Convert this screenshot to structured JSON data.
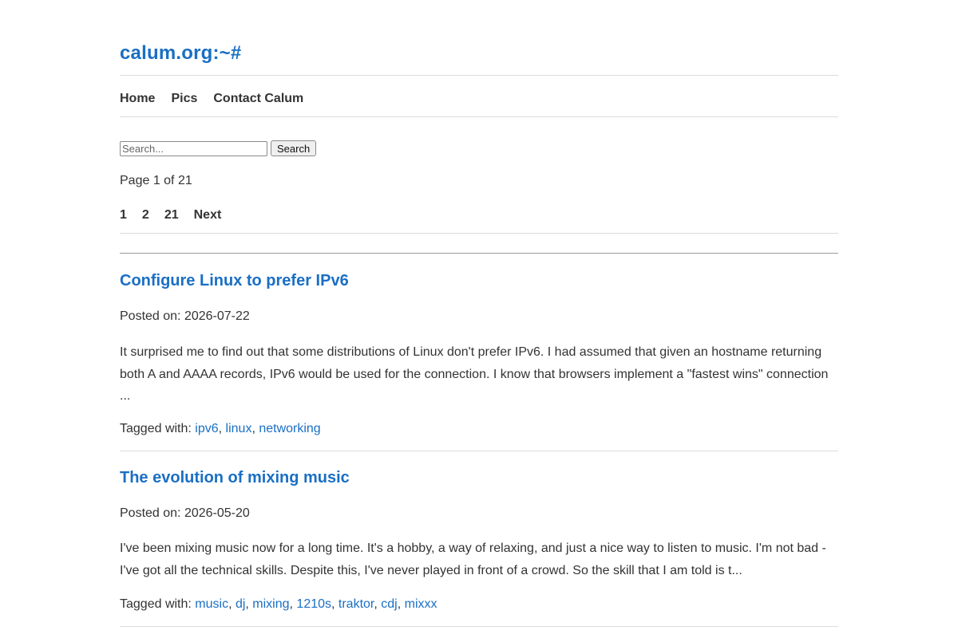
{
  "site": {
    "title": "calum.org:~#"
  },
  "nav": {
    "items": [
      "Home",
      "Pics",
      "Contact Calum"
    ]
  },
  "search": {
    "placeholder": "Search...",
    "button_label": "Search"
  },
  "pagination": {
    "info": "Page 1 of 21",
    "links": [
      "1",
      "2",
      "21",
      "Next"
    ]
  },
  "posts": [
    {
      "title": "Configure Linux to prefer IPv6",
      "date_prefix": "Posted on: ",
      "date": "2026-07-22",
      "excerpt": "It surprised me to find out that some distributions of Linux don't prefer IPv6. I had assumed that given an hostname returning both A and AAAA records, IPv6 would be used for the connection. I know that browsers implement a \"fastest wins\" connection ...",
      "tags_prefix": "Tagged with: ",
      "tags": [
        "ipv6",
        "linux",
        "networking"
      ]
    },
    {
      "title": "The evolution of mixing music",
      "date_prefix": "Posted on: ",
      "date": "2026-05-20",
      "excerpt": "I've been mixing music now for a long time. It's a hobby, a way of relaxing, and just a nice way to listen to music. I'm not bad - I've got all the technical skills. Despite this, I've never played in front of a crowd. So the skill that I am told is t...",
      "tags_prefix": "Tagged with: ",
      "tags": [
        "music",
        "dj",
        "mixing",
        "1210s",
        "traktor",
        "cdj",
        "mixxx"
      ]
    }
  ],
  "colors": {
    "link": "#1a6fc4",
    "text": "#333333",
    "rule": "#dcdcdc"
  }
}
